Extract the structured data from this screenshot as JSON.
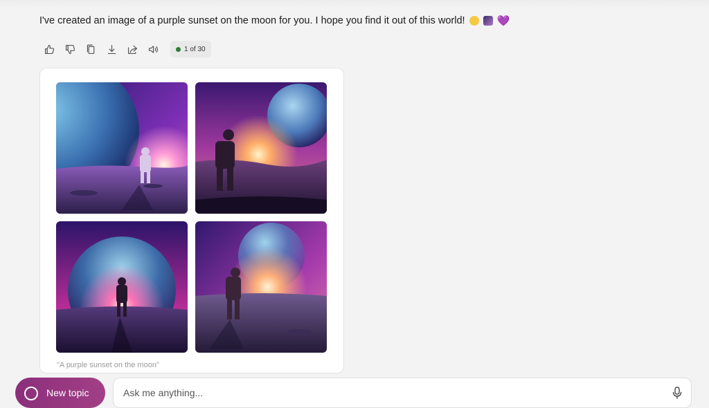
{
  "message": {
    "text": "I've created an image of a purple sunset on the moon for you. I hope you find it out of this world!",
    "emojis": [
      "moon-emoji",
      "night-sky-emoji",
      "purple-heart-emoji"
    ],
    "heart": "💜"
  },
  "actions": {
    "icons": [
      "thumbs-up-icon",
      "thumbs-down-icon",
      "copy-icon",
      "download-icon",
      "share-icon",
      "read-aloud-icon"
    ],
    "turn_counter": "1 of 30",
    "turn_status_color": "#2e7d32"
  },
  "images": {
    "caption": "\"A purple sunset on the moon\"",
    "tiles": [
      "generated-image-1",
      "generated-image-2",
      "generated-image-3",
      "generated-image-4"
    ]
  },
  "composer": {
    "new_topic_label": "New topic",
    "input_placeholder": "Ask me anything...",
    "accent": "#8b2f7a"
  }
}
